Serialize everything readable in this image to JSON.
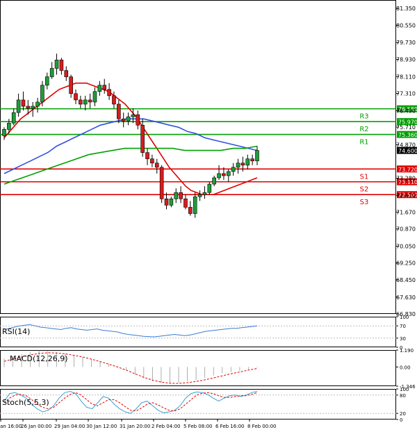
{
  "chart_data": {
    "type": "candlestick",
    "title": "",
    "price_axis": {
      "ticks": [
        "81.350",
        "80.550",
        "79.730",
        "78.930",
        "78.110",
        "77.310",
        "76.490",
        "75.710",
        "74.870",
        "73.280",
        "72.470",
        "71.670",
        "70.870",
        "70.050",
        "69.250",
        "68.450",
        "67.630",
        "66.830"
      ],
      "tick_values": [
        81.35,
        80.55,
        79.73,
        78.93,
        78.11,
        77.31,
        76.49,
        75.71,
        74.87,
        73.28,
        72.47,
        71.67,
        70.87,
        70.05,
        69.25,
        68.45,
        67.63,
        66.83
      ],
      "ylim": [
        66.83,
        81.75
      ]
    },
    "time_axis": {
      "labels": [
        "Jan 16:00",
        "26 Jan 00:00",
        "29 Jan 04:00",
        "30 Jan 12:00",
        "31 Jan 20:00",
        "2 Feb 04:00",
        "5 Feb 08:00",
        "6 Feb 16:00",
        "8 Feb 00:00"
      ]
    },
    "levels": [
      {
        "name": "R3",
        "value": 76.58,
        "label": "76.580",
        "color": "#00a000"
      },
      {
        "name": "R2",
        "value": 75.97,
        "label": "75.970",
        "color": "#00a000"
      },
      {
        "name": "R1",
        "value": 75.36,
        "label": "75.360",
        "color": "#00a000"
      },
      {
        "name": "S1",
        "value": 73.72,
        "label": "73.720",
        "color": "#e00000"
      },
      {
        "name": "S2",
        "value": 73.11,
        "label": "73.110",
        "color": "#e00000"
      },
      {
        "name": "S3",
        "value": 72.5,
        "label": "72.500",
        "color": "#e00000"
      }
    ],
    "current_price": {
      "value": 74.6,
      "label": "74.600"
    },
    "candles": [
      [
        75.3,
        75.7,
        75.1,
        75.6
      ],
      [
        75.6,
        76.1,
        75.4,
        75.9
      ],
      [
        75.9,
        76.6,
        75.8,
        76.4
      ],
      [
        76.4,
        77.3,
        76.2,
        77.0
      ],
      [
        77.0,
        77.4,
        76.5,
        76.7
      ],
      [
        76.7,
        77.0,
        76.3,
        76.6
      ],
      [
        76.6,
        76.9,
        76.2,
        76.7
      ],
      [
        76.7,
        77.1,
        76.4,
        76.9
      ],
      [
        76.9,
        77.9,
        76.7,
        77.7
      ],
      [
        77.7,
        78.3,
        77.5,
        78.1
      ],
      [
        78.1,
        78.8,
        78.0,
        78.5
      ],
      [
        78.5,
        79.2,
        78.2,
        78.9
      ],
      [
        78.9,
        79.0,
        78.2,
        78.4
      ],
      [
        78.4,
        78.6,
        77.9,
        78.1
      ],
      [
        78.1,
        78.2,
        77.1,
        77.3
      ],
      [
        77.3,
        77.5,
        76.8,
        77.0
      ],
      [
        77.0,
        77.2,
        76.6,
        76.8
      ],
      [
        76.8,
        77.2,
        76.5,
        77.0
      ],
      [
        77.0,
        77.3,
        76.6,
        76.9
      ],
      [
        76.9,
        77.6,
        76.7,
        77.4
      ],
      [
        77.4,
        77.9,
        77.2,
        77.7
      ],
      [
        77.7,
        78.0,
        77.3,
        77.5
      ],
      [
        77.5,
        77.8,
        77.0,
        77.2
      ],
      [
        77.2,
        77.4,
        76.6,
        76.8
      ],
      [
        76.8,
        77.0,
        75.9,
        76.1
      ],
      [
        76.1,
        76.4,
        75.7,
        76.0
      ],
      [
        76.0,
        76.4,
        75.8,
        76.2
      ],
      [
        76.2,
        76.6,
        75.9,
        76.3
      ],
      [
        76.3,
        76.5,
        75.6,
        75.8
      ],
      [
        75.8,
        76.1,
        74.3,
        74.5
      ],
      [
        74.5,
        74.7,
        73.9,
        74.2
      ],
      [
        74.2,
        74.4,
        73.8,
        74.0
      ],
      [
        74.0,
        74.2,
        73.5,
        73.8
      ],
      [
        73.8,
        73.9,
        72.1,
        72.3
      ],
      [
        72.3,
        72.6,
        71.8,
        72.0
      ],
      [
        72.0,
        72.4,
        71.9,
        72.3
      ],
      [
        72.3,
        72.8,
        72.1,
        72.6
      ],
      [
        72.6,
        72.9,
        72.1,
        72.3
      ],
      [
        72.3,
        72.5,
        71.8,
        71.9
      ],
      [
        71.9,
        72.2,
        71.5,
        71.6
      ],
      [
        71.6,
        72.6,
        71.4,
        72.4
      ],
      [
        72.4,
        72.7,
        72.2,
        72.5
      ],
      [
        72.5,
        72.9,
        72.3,
        72.6
      ],
      [
        72.6,
        73.1,
        72.5,
        73.0
      ],
      [
        73.0,
        73.4,
        72.9,
        73.3
      ],
      [
        73.3,
        73.9,
        73.2,
        73.5
      ],
      [
        73.5,
        73.8,
        73.2,
        73.4
      ],
      [
        73.4,
        73.7,
        73.1,
        73.6
      ],
      [
        73.6,
        74.0,
        73.4,
        73.8
      ],
      [
        73.8,
        74.2,
        73.5,
        74.0
      ],
      [
        74.0,
        74.3,
        73.6,
        73.9
      ],
      [
        73.9,
        74.4,
        73.7,
        74.2
      ],
      [
        74.2,
        74.4,
        73.9,
        74.1
      ],
      [
        74.1,
        74.8,
        73.9,
        74.6
      ]
    ],
    "ma_lines": [
      {
        "name": "MA fast",
        "color": "#e00000",
        "values": [
          75.2,
          75.5,
          75.8,
          76.1,
          76.3,
          76.5,
          76.7,
          76.9,
          77.1,
          77.3,
          77.5,
          77.6,
          77.7,
          77.8,
          77.8,
          77.8,
          77.7,
          77.6,
          77.5,
          77.4,
          77.2,
          77.0,
          76.8,
          76.5,
          76.2,
          75.8,
          75.4,
          75.0,
          74.6,
          74.2,
          73.8,
          73.5,
          73.2,
          72.9,
          72.7,
          72.6,
          72.5,
          72.5,
          72.5,
          72.6,
          72.7,
          72.8,
          72.9,
          73.0,
          73.1,
          73.2,
          73.3
        ]
      },
      {
        "name": "MA medium",
        "color": "#3050e0",
        "values": [
          73.5,
          73.7,
          73.9,
          74.1,
          74.3,
          74.5,
          74.8,
          75.0,
          75.2,
          75.4,
          75.6,
          75.8,
          75.9,
          76.0,
          76.1,
          76.1,
          76.1,
          76.0,
          75.9,
          75.8,
          75.7,
          75.5,
          75.4,
          75.2,
          75.1,
          75.0,
          74.9,
          74.8,
          74.7,
          74.6
        ]
      },
      {
        "name": "MA slow",
        "color": "#00a000",
        "values": [
          73.0,
          73.2,
          73.4,
          73.6,
          73.8,
          74.0,
          74.2,
          74.4,
          74.5,
          74.6,
          74.7,
          74.7,
          74.7,
          74.7,
          74.7,
          74.6,
          74.6,
          74.6,
          74.6,
          74.7,
          74.7,
          74.8
        ]
      }
    ],
    "panels": [
      {
        "name": "RSI(14)",
        "ticks": [
          "100",
          "70",
          "30",
          "0"
        ],
        "tick_values": [
          100,
          70,
          30,
          0
        ]
      },
      {
        "name": "MACD(12,26,9)",
        "ticks": [
          "1.190",
          "0.00",
          "-1.346"
        ],
        "tick_values": [
          1.19,
          0,
          -1.346
        ]
      },
      {
        "name": "Stoch(5,5,3)",
        "ticks": [
          "100",
          "80",
          "20",
          "0"
        ],
        "tick_values": [
          100,
          80,
          20,
          0
        ]
      }
    ],
    "rsi": [
      58,
      62,
      66,
      70,
      72,
      74,
      70,
      66,
      64,
      62,
      60,
      58,
      62,
      64,
      60,
      58,
      56,
      58,
      60,
      56,
      54,
      52,
      50,
      45,
      42,
      40,
      38,
      36,
      35,
      34,
      36,
      38,
      40,
      42,
      40,
      38,
      40,
      44,
      48,
      52,
      54,
      56,
      58,
      60,
      62,
      62,
      64,
      66,
      68,
      70
    ],
    "macd_hist": [
      0.6,
      0.75,
      0.9,
      1.05,
      1.15,
      1.12,
      1.05,
      0.95,
      0.85,
      0.7,
      0.55,
      0.4,
      0.2,
      0.0,
      -0.25,
      -0.55,
      -0.8,
      -1.0,
      -1.1,
      -1.15,
      -1.1,
      -1.0,
      -0.9,
      -0.75,
      -0.6,
      -0.45,
      -0.35,
      -0.25,
      -0.15,
      -0.05
    ],
    "macd_signal": [
      0.4,
      0.55,
      0.7,
      0.85,
      0.95,
      1.0,
      0.98,
      0.92,
      0.82,
      0.7,
      0.55,
      0.38,
      0.2,
      0.0,
      -0.22,
      -0.48,
      -0.72,
      -0.92,
      -1.06,
      -1.14,
      -1.15,
      -1.1,
      -1.02,
      -0.9,
      -0.77,
      -0.62,
      -0.48,
      -0.35,
      -0.22,
      -0.1
    ],
    "stoch_k": [
      60,
      85,
      88,
      80,
      70,
      50,
      35,
      25,
      30,
      45,
      70,
      88,
      92,
      85,
      60,
      40,
      35,
      55,
      75,
      70,
      50,
      35,
      25,
      20,
      35,
      55,
      60,
      45,
      30,
      22,
      25,
      30,
      45,
      70,
      85,
      90,
      88,
      82,
      70,
      60,
      70,
      78,
      80,
      75,
      80,
      88,
      92
    ],
    "stoch_d": [
      55,
      70,
      80,
      82,
      78,
      65,
      50,
      40,
      35,
      40,
      55,
      70,
      82,
      88,
      80,
      65,
      50,
      45,
      55,
      65,
      65,
      55,
      42,
      30,
      28,
      38,
      50,
      55,
      48,
      38,
      30,
      28,
      35,
      50,
      65,
      80,
      86,
      88,
      85,
      78,
      72,
      72,
      75,
      78,
      78,
      82,
      88
    ]
  }
}
